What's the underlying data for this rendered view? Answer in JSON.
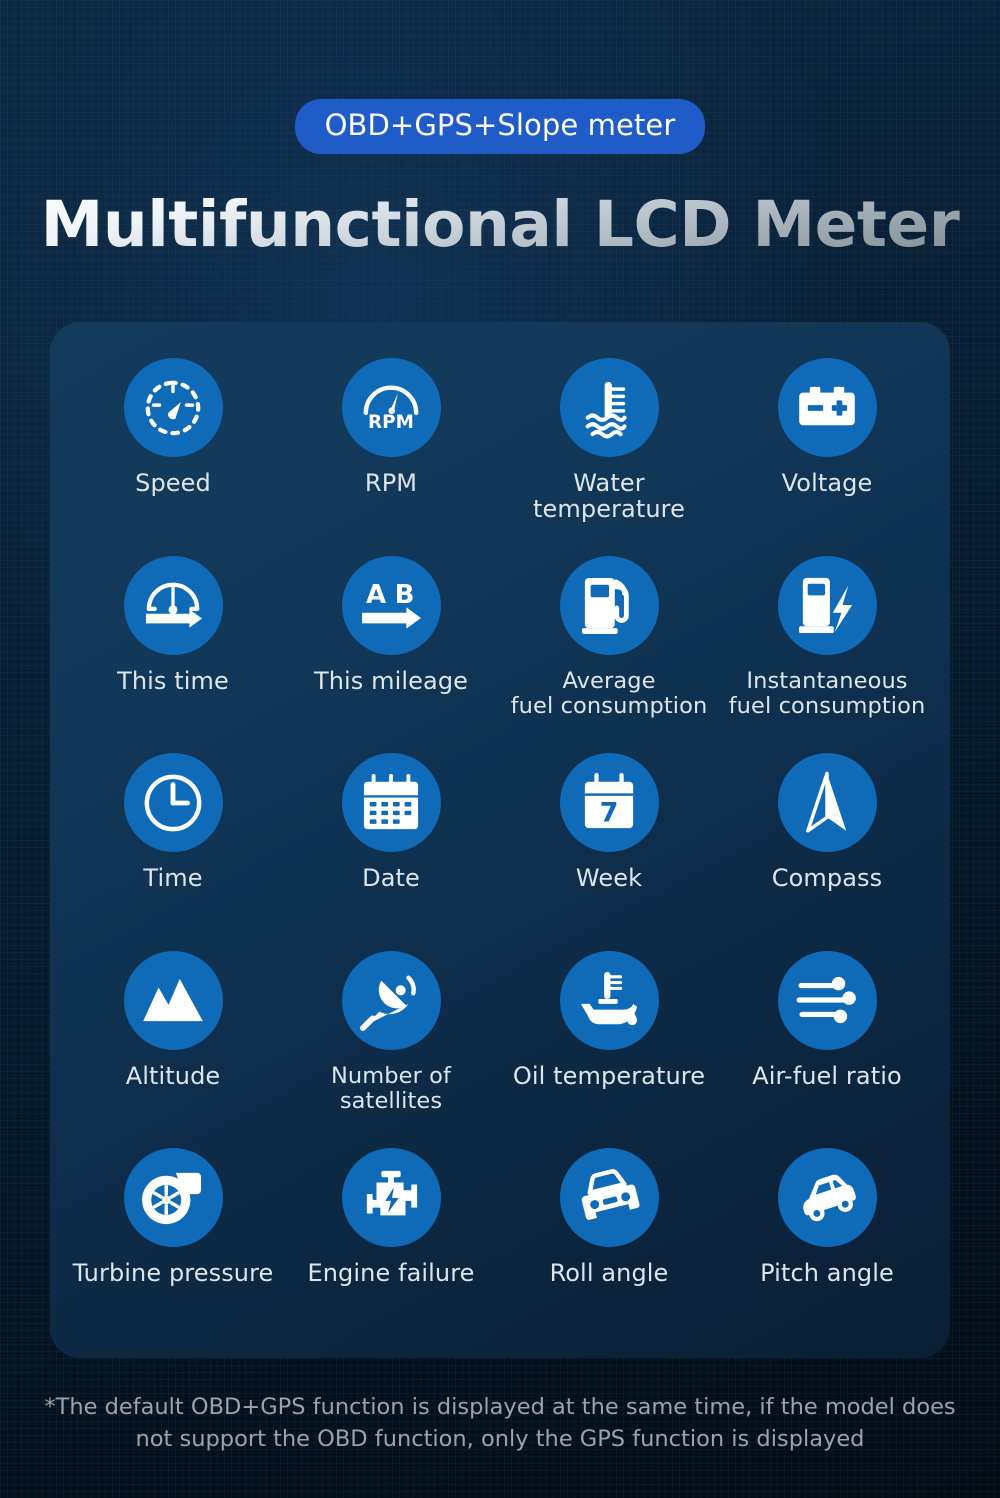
{
  "header": {
    "badge": "OBD+GPS+Slope meter",
    "title": "Multifunctional LCD Meter"
  },
  "colors": {
    "badge_bg": "#1f5cc8",
    "icon_circle": "#0f6ab8",
    "panel_bg": "#133b5c",
    "page_bg": "#061320",
    "label_text": "#dde4ea",
    "footnote_text": "#97a3ad"
  },
  "features": [
    {
      "icon": "speedometer-icon",
      "label": "Speed"
    },
    {
      "icon": "rpm-gauge-icon",
      "label": "RPM"
    },
    {
      "icon": "water-temperature-icon",
      "label": "Water temperature"
    },
    {
      "icon": "battery-icon",
      "label": "Voltage"
    },
    {
      "icon": "trip-time-icon",
      "label": "This time"
    },
    {
      "icon": "trip-mileage-ab-icon",
      "label": "This mileage"
    },
    {
      "icon": "fuel-pump-icon",
      "label": "Average\nfuel consumption"
    },
    {
      "icon": "fuel-pump-bolt-icon",
      "label": "Instantaneous\nfuel consumption"
    },
    {
      "icon": "clock-icon",
      "label": "Time"
    },
    {
      "icon": "calendar-icon",
      "label": "Date"
    },
    {
      "icon": "calendar-week-7-icon",
      "label": "Week"
    },
    {
      "icon": "compass-needle-icon",
      "label": "Compass"
    },
    {
      "icon": "mountains-icon",
      "label": "Altitude"
    },
    {
      "icon": "satellite-dish-icon",
      "label": "Number of\nsatellites"
    },
    {
      "icon": "oil-temperature-icon",
      "label": "Oil temperature"
    },
    {
      "icon": "air-flow-icon",
      "label": "Air-fuel ratio"
    },
    {
      "icon": "turbocharger-icon",
      "label": "Turbine pressure"
    },
    {
      "icon": "check-engine-icon",
      "label": "Engine failure"
    },
    {
      "icon": "car-front-tilt-icon",
      "label": "Roll angle"
    },
    {
      "icon": "car-side-incline-icon",
      "label": "Pitch angle"
    }
  ],
  "footnote": "*The default OBD+GPS function is displayed at the same time, if the model does not support the OBD function, only the GPS function is displayed"
}
